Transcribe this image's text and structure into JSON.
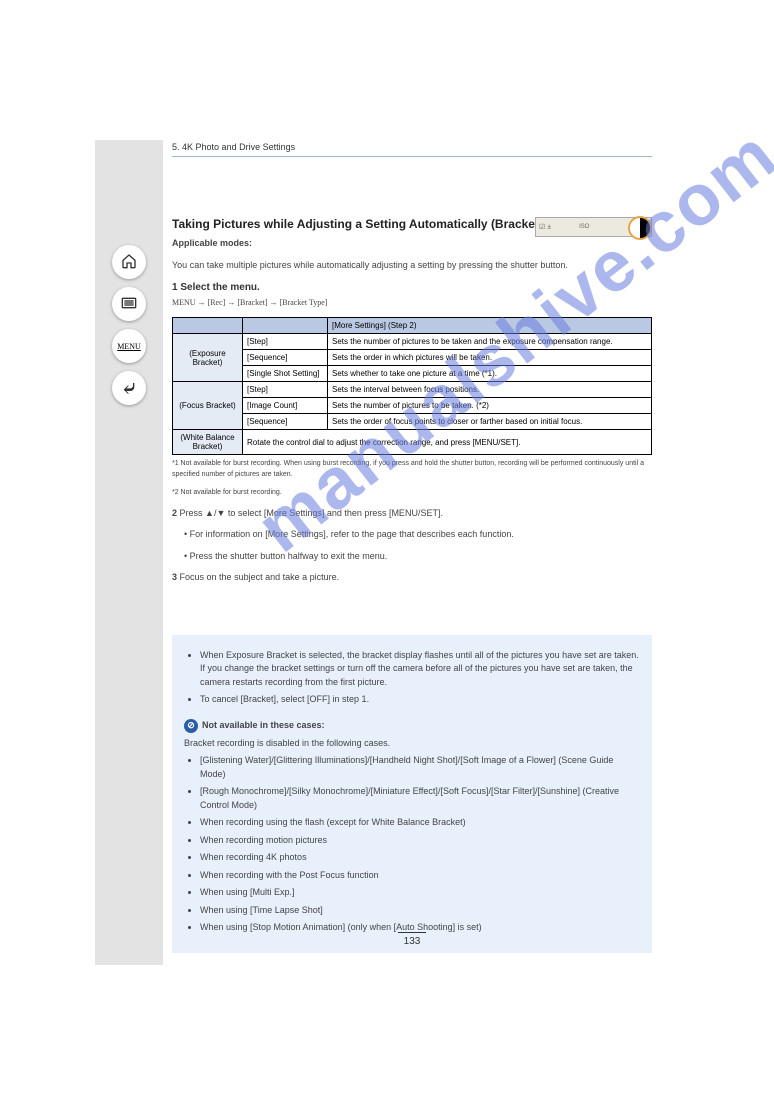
{
  "watermark": "manualshive.com",
  "sidebar": {
    "menu_label": "MENU"
  },
  "header": {
    "chapter_num": "5.",
    "chapter_title": "4K Photo and Drive Settings"
  },
  "top_right": {
    "icons": "☑ ±",
    "iso_label": "ISO"
  },
  "title": "Taking Pictures while Adjusting a Setting Automatically (Bracket Recording)",
  "intro_applicable": "Applicable modes:",
  "intro_text": "You can take multiple pictures while automatically adjusting a setting by pressing the shutter button.",
  "step_1": "Select the menu.",
  "menu_path": "MENU → [Rec] → [Bracket] → [Bracket Type]",
  "table": {
    "headers": [
      "",
      "",
      "[More Settings]",
      "(Step 2)"
    ],
    "rows": [
      {
        "group": "(Exposure Bracket)",
        "items": [
          {
            "name": "[Step]",
            "desc": "Sets the number of pictures to be taken and the exposure compensation range."
          },
          {
            "name": "[Sequence]",
            "desc": "Sets the order in which pictures will be taken."
          },
          {
            "name": "[Single Shot Setting]",
            "desc": "Sets whether to take one picture at a time (*1)."
          }
        ]
      },
      {
        "group": "(Focus Bracket)",
        "items": [
          {
            "name": "[Step]",
            "desc": "Sets the interval between focus positions."
          },
          {
            "name": "[Image Count]",
            "desc": "Sets the number of pictures to be taken. (*2)"
          },
          {
            "name": "[Sequence]",
            "desc": "Sets the order of focus points to closer or farther based on initial focus."
          }
        ]
      },
      {
        "group": "(White Balance Bracket)",
        "items": [
          {
            "name": "",
            "desc": "Rotate the control dial to adjust the correction range, and press [MENU/SET]."
          }
        ]
      }
    ],
    "footnote1": "*1 Not available for burst recording. When using burst recording, if you press and hold the shutter button, recording will be performed continuously until a specified number of pictures are taken.",
    "footnote2": "*2 Not available for burst recording."
  },
  "step_2_lead": "2",
  "step_2_text": "Press ▲/▼ to select [More Settings] and then press [MENU/SET].",
  "step_2_bullets": [
    "For information on [More Settings], refer to the page that describes each function.",
    "Press the shutter button halfway to exit the menu."
  ],
  "step_3_lead": "3",
  "step_3_text": "Focus on the subject and take a picture.",
  "notes": {
    "bullets": [
      "When Exposure Bracket is selected, the bracket display flashes until all of the pictures you have set are taken. If you change the bracket settings or turn off the camera before all of the pictures you have set are taken, the camera restarts recording from the first picture.",
      "To cancel [Bracket], select [OFF] in step 1."
    ],
    "unavailable_title": "Not available in these cases:",
    "unavailable_lead": "Bracket recording is disabled in the following cases.",
    "unavailable_items": [
      "[Glistening Water]/[Glittering Illuminations]/[Handheld Night Shot]/[Soft Image of a Flower] (Scene Guide Mode)",
      "[Rough Monochrome]/[Silky Monochrome]/[Miniature Effect]/[Soft Focus]/[Star Filter]/[Sunshine] (Creative Control Mode)",
      "When recording using the flash (except for White Balance Bracket)",
      "When recording motion pictures",
      "When recording 4K photos",
      "When recording with the Post Focus function",
      "When using [Multi Exp.]",
      "When using [Time Lapse Shot]",
      "When using [Stop Motion Animation] (only when [Auto Shooting] is set)"
    ]
  },
  "page_number": "133"
}
